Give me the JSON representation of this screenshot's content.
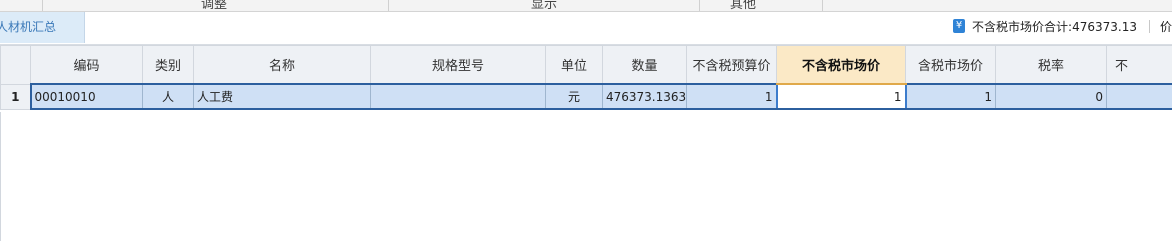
{
  "topbar": {
    "labels": [
      "调整",
      "显示",
      "其他"
    ]
  },
  "tab": {
    "label": "人材机汇总"
  },
  "summary": {
    "currency_icon": "yen-icon",
    "label": "不含税市场价合计:",
    "value": "476373.13",
    "next_label": "价"
  },
  "grid": {
    "columns": [
      "编码",
      "类别",
      "名称",
      "规格型号",
      "单位",
      "数量",
      "不含税预算价",
      "不含税市场价",
      "含税市场价",
      "税率",
      "不"
    ],
    "active_column": "不含税市场价",
    "rows": [
      {
        "num": "1",
        "code": "00010010",
        "category": "人",
        "name": "人工费",
        "spec": "",
        "unit": "元",
        "qty": "476373.1363",
        "budget_price": "1",
        "market_price": "1",
        "tax_market_price": "1",
        "tax_rate": "0",
        "extra": ""
      }
    ]
  },
  "colors": {
    "tab_bg": "#dcebf8",
    "selected_row": "#cfe0f5",
    "active_header": "#fbe9c6",
    "accent_blue": "#2f83d6"
  }
}
